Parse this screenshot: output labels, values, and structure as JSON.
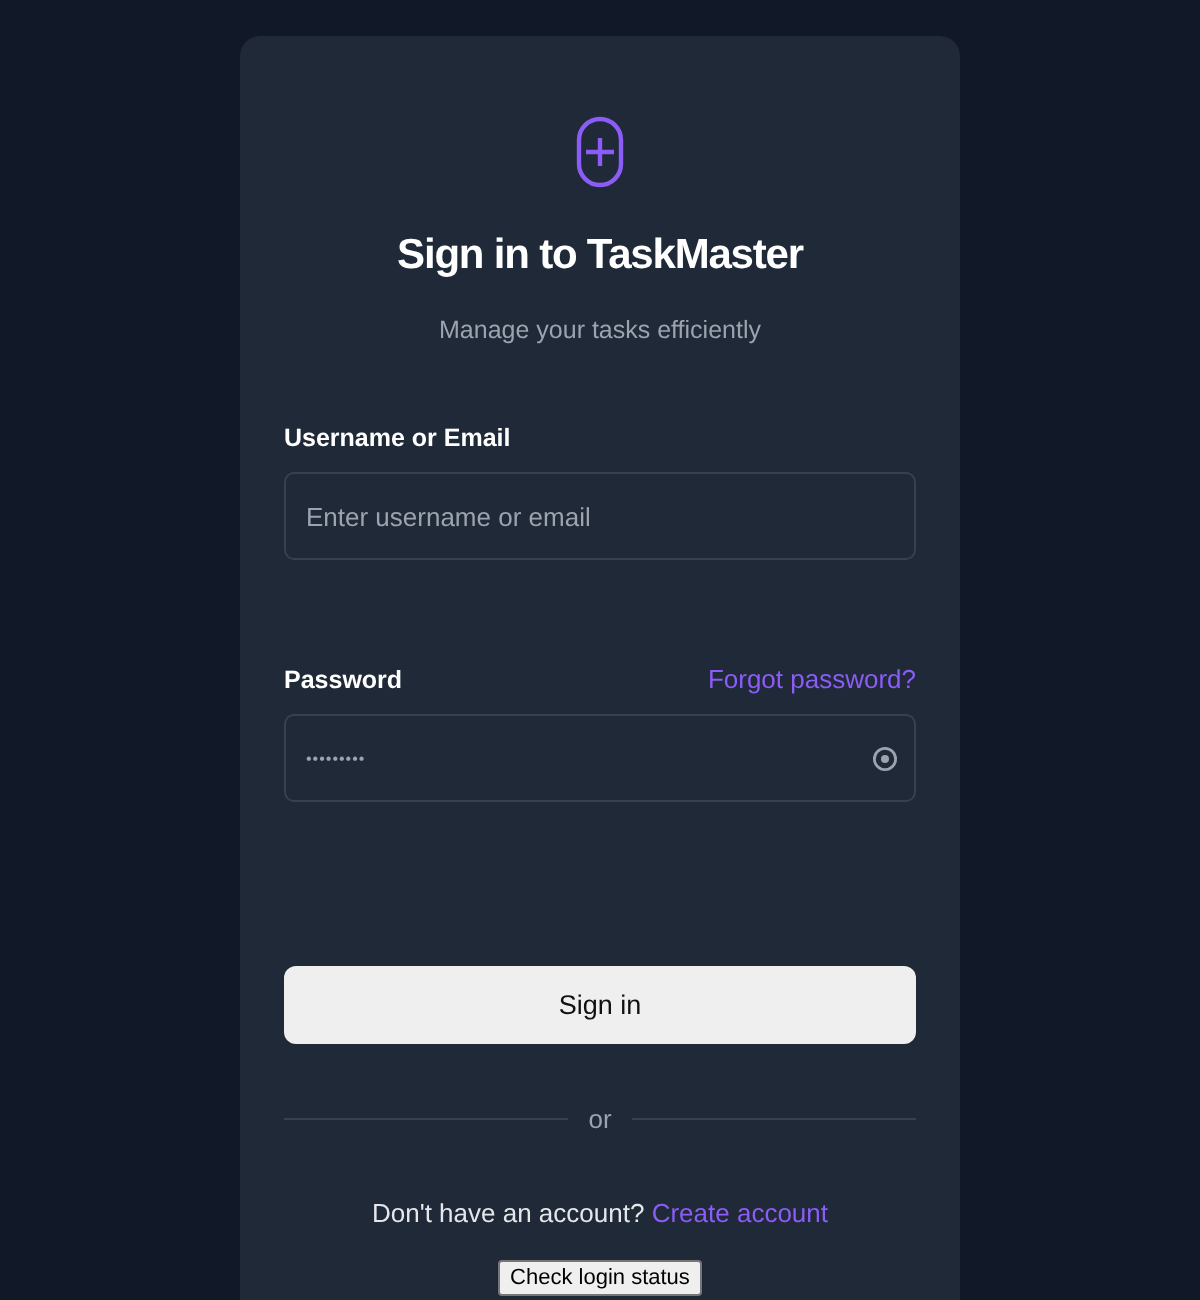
{
  "title": "Sign in to TaskMaster",
  "subtitle": "Manage your tasks efficiently",
  "username": {
    "label": "Username or Email",
    "placeholder": "Enter username or email"
  },
  "password": {
    "label": "Password",
    "value": "•••••••••",
    "forgot_link": "Forgot password?"
  },
  "sign_in_button": "Sign in",
  "divider": "or",
  "signup": {
    "text": "Don't have an account?",
    "link": "Create account"
  },
  "status_button": "Check login status"
}
